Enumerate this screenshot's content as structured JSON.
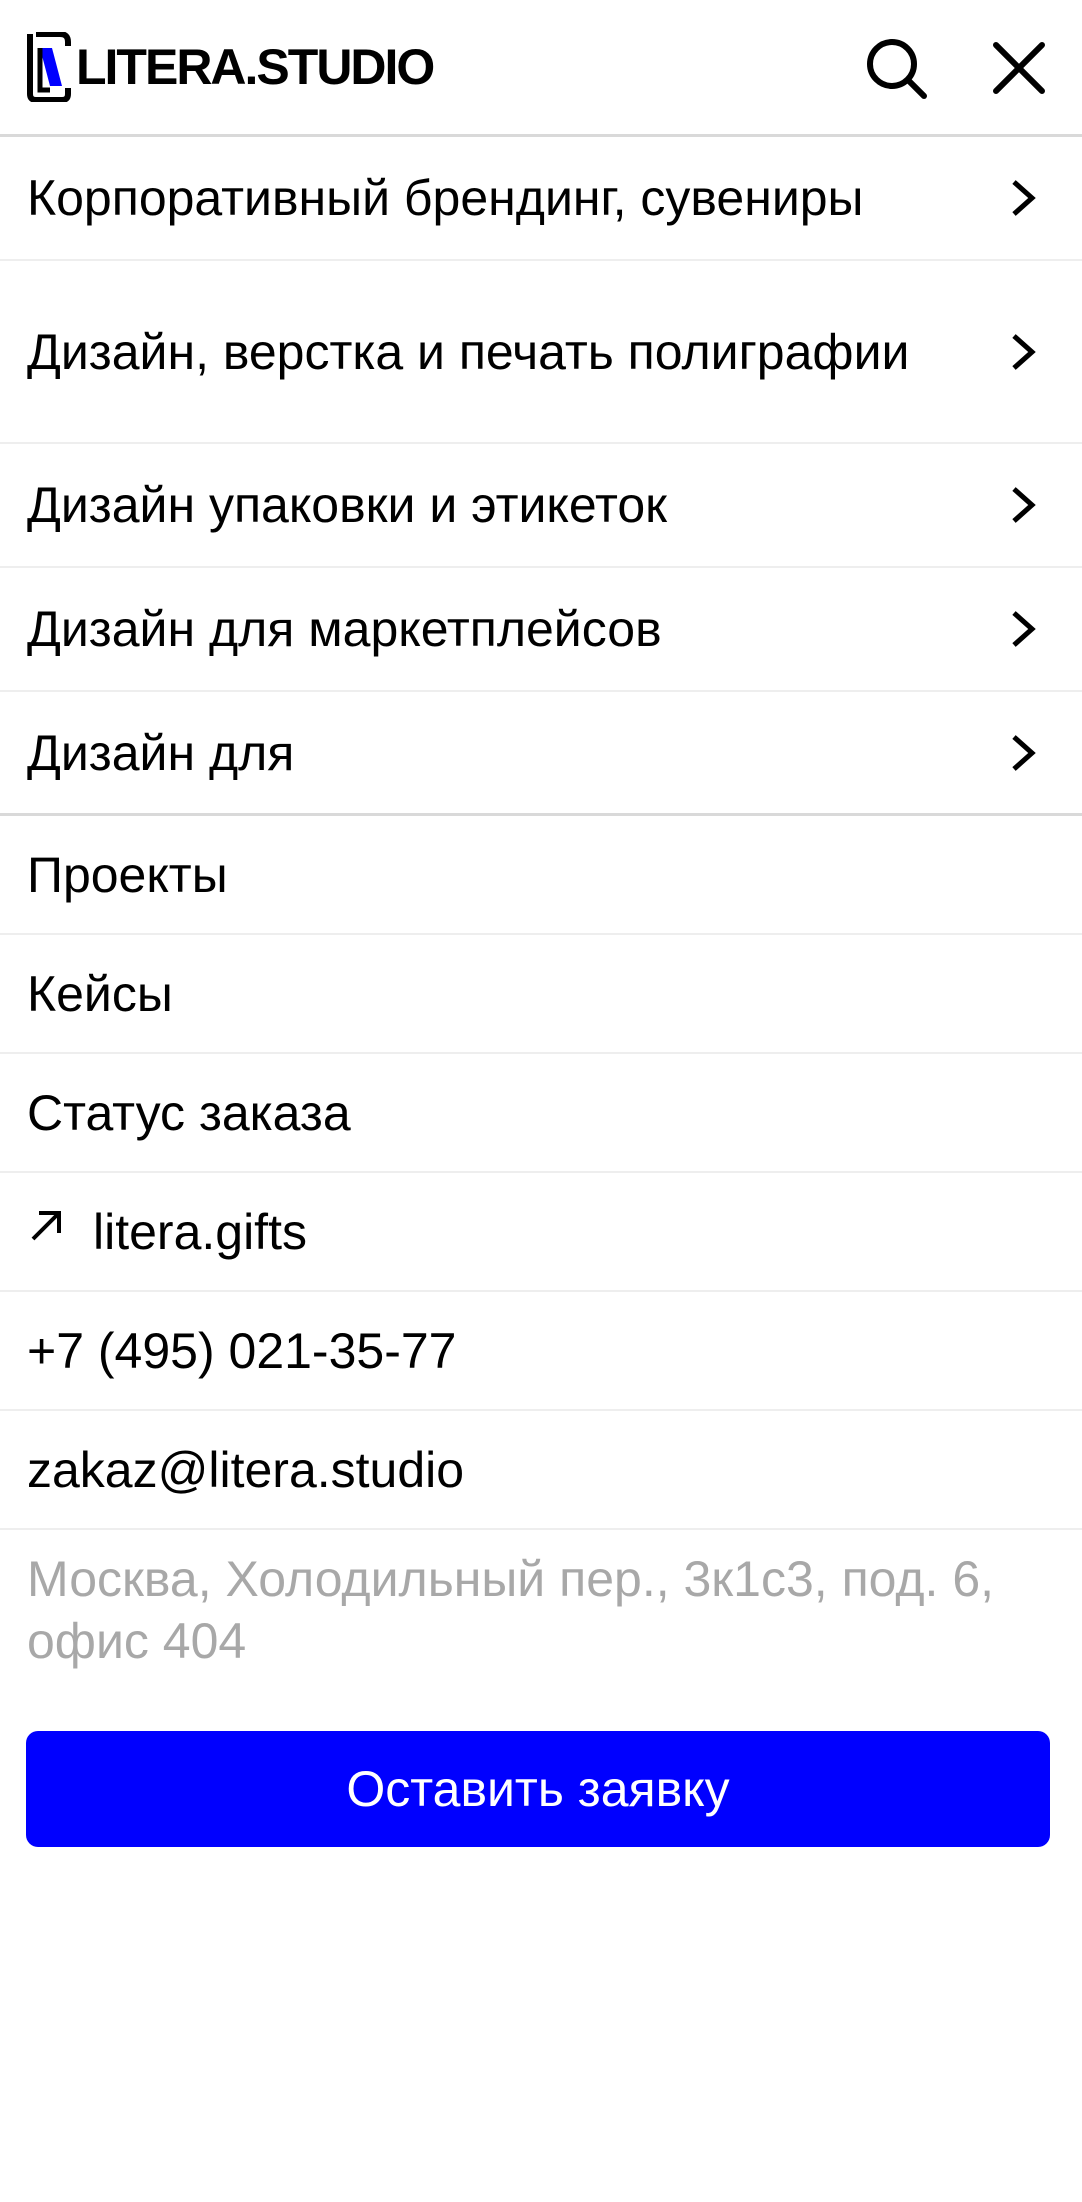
{
  "header": {
    "logo_text": "LITERA.STUDIO",
    "search_icon": "search-icon",
    "close_icon": "close-icon"
  },
  "categories": [
    {
      "label": "Корпоративный брендинг, сувениры"
    },
    {
      "label": "Дизайн, верстка и печать полиграфии"
    },
    {
      "label": "Дизайн упаковки и этикеток"
    },
    {
      "label": "Дизайн для маркетплейсов"
    },
    {
      "label": "Дизайн для"
    }
  ],
  "links": [
    {
      "label": "Проекты"
    },
    {
      "label": "Кейсы"
    },
    {
      "label": "Статус заказа"
    }
  ],
  "external_link": {
    "label": "litera.gifts",
    "icon": "arrow-up-right-icon"
  },
  "contacts": {
    "phone": "+7 (495) 021-35-77",
    "email": "zakaz@litera.studio",
    "address": "Москва, Холодильный пер., 3к1с3, под. 6, офис 404"
  },
  "cta": {
    "label": "Оставить заявку"
  },
  "colors": {
    "accent": "#0000ff",
    "address_text": "#a8a8a8",
    "divider": "#eeeeee"
  }
}
